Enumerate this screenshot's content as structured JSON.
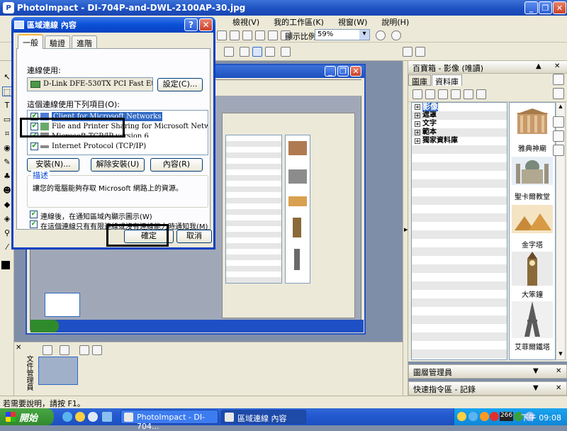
{
  "app": {
    "title": "PhotoImpact - DI-704P-and-DWL-2100AP-30.jpg",
    "menu": [
      "檢視(V)",
      "我的工作區(K)",
      "視窗(W)",
      "說明(H)"
    ],
    "zoom_label": "顯示比例",
    "zoom_value": "59%",
    "status_text": "若需要說明，請按 F1。"
  },
  "dialog": {
    "title": "區域連線 內容",
    "tabs": [
      "一般",
      "驗證",
      "進階"
    ],
    "connect_using_label": "連線使用:",
    "adapter": "D-Link DFE-530TX PCI Fast Etherne",
    "configure_button": "設定(C)...",
    "items_label": "這個連線使用下列項目(O):",
    "items": [
      {
        "text": "Client for Microsoft Networks",
        "checked": true,
        "selected": true
      },
      {
        "text": "File and Printer Sharing for Microsoft Networks",
        "checked": true,
        "selected": false
      },
      {
        "text": "Microsoft TCP/IP version 6",
        "checked": true,
        "selected": false
      },
      {
        "text": "Internet Protocol (TCP/IP)",
        "checked": true,
        "selected": false
      }
    ],
    "install_button": "安裝(N)...",
    "uninstall_button": "解除安裝(U)",
    "properties_button": "內容(R)",
    "description_title": "描述",
    "description_text": "讓您的電腦能夠存取 Microsoft 網路上的資源。",
    "show_icon_option": "連線後，在通知區域內顯示圖示(W)",
    "notify_option": "在這個連線只有有限連線或沒有連線能力時通知我(M)",
    "ok_button": "確定",
    "cancel_button": "取消"
  },
  "gallery": {
    "title": "百寶箱 - 影像 (唯讀)",
    "tabs": [
      "圖庫",
      "資料庫"
    ],
    "tree": [
      "影像",
      "遮罩",
      "文字",
      "範本",
      "獨家資料庫"
    ],
    "thumbs": [
      "雅典神廟",
      "聖卡爾教堂",
      "金字塔",
      "大笨鐘",
      "艾菲爾鐵塔"
    ]
  },
  "panels": {
    "layer_manager": "圖層管理員",
    "quick_command": "快速指令區 - 記錄",
    "doc_manager": "文件管理員"
  },
  "taskbar": {
    "start_label": "開始",
    "tasks": [
      "PhotoImpact - DI-704...",
      "區域連線 內容"
    ],
    "clock": "下午 09:08",
    "tray_number": "266"
  },
  "colors": {
    "xp_blue": "#0a50d8",
    "start_green": "#2f8a2c",
    "panel_bg": "#ece9d8"
  }
}
